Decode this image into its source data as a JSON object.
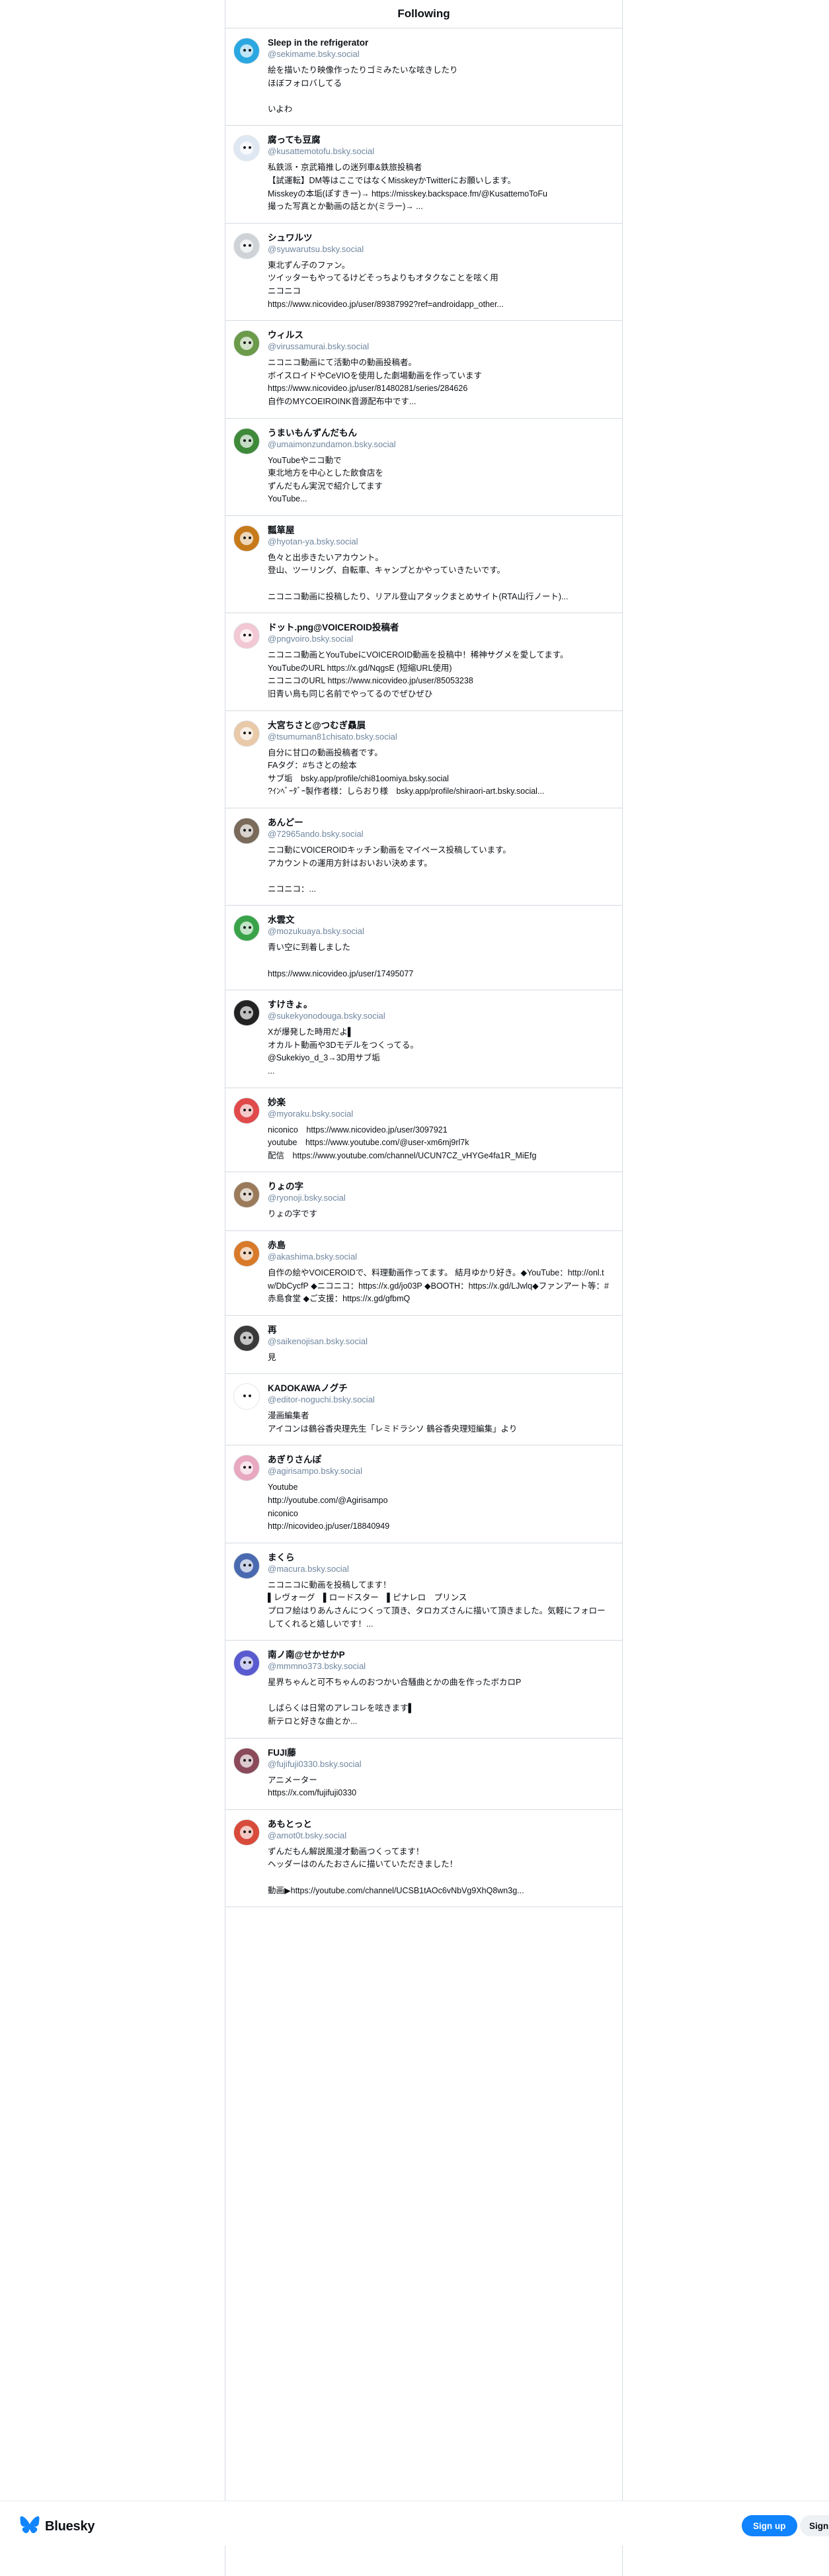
{
  "header": {
    "title": "Following"
  },
  "footer": {
    "brand": "Bluesky",
    "signup_label": "Sign up",
    "signin_label": "Sign in"
  },
  "follows": [
    {
      "name": "Sleep in the refrigerator",
      "handle": "@sekimame.bsky.social",
      "description": "絵を描いたり映像作ったりゴミみたいな呟きしたり\nほぼフォロバしてる\n\nいよわ",
      "avatar_color": "#2aa7e0"
    },
    {
      "name": "腐っても豆腐",
      "handle": "@kusattemotofu.bsky.social",
      "description": "私鉄派・京武箱推しの迷列車&鉄旅投稿者\n【試運転】DM等はここではなくMisskeyかTwitterにお願いします。\nMisskeyの本垢(ぽすきー)→ https://misskey.backspace.fm/@KusattemoToFu\n撮った写真とか動画の話とか(ミラー)→ ...",
      "avatar_color": "#dfe8f2"
    },
    {
      "name": "シュワルツ",
      "handle": "@syuwarutsu.bsky.social",
      "description": "東北ずん子のファン。\nツイッターもやってるけどそっちよりもオタクなことを呟く用\nニコニコ\nhttps://www.nicovideo.jp/user/89387992?ref=androidapp_other...",
      "avatar_color": "#cfd3d8"
    },
    {
      "name": "ウィルス",
      "handle": "@virussamurai.bsky.social",
      "description": "ニコニコ動画にて活動中の動画投稿者。\nボイスロイドやCeVIOを使用した劇場動画を作っています\nhttps://www.nicovideo.jp/user/81480281/series/284626\n自作のMYCOEIROINK音源配布中です...",
      "avatar_color": "#6a9a4a"
    },
    {
      "name": "うまいもんずんだもん",
      "handle": "@umaimonzundamon.bsky.social",
      "description": "YouTubeやニコ動で\n東北地方を中心とした飲食店を\nずんだもん実況で紹介してます\nYouTube...",
      "avatar_color": "#3f8a3a"
    },
    {
      "name": "瓢箪屋",
      "handle": "@hyotan-ya.bsky.social",
      "description": "色々と出歩きたいアカウント。\n登山、ツーリング、自転車、キャンプとかやっていきたいです。\n\nニコニコ動画に投稿したり、リアル登山アタックまとめサイト(RTA山行ノート)...",
      "avatar_color": "#c77a1a"
    },
    {
      "name": "ドット.png@VOICEROID投稿者",
      "handle": "@pngvoiro.bsky.social",
      "description": "ニコニコ動画とYouTubeにVOICEROID動画を投稿中！稀神サグメを愛してます。\nYouTubeのURL https://x.gd/NqgsE (短縮URL使用)\nニコニコのURL https://www.nicovideo.jp/user/85053238\n旧青い鳥も同じ名前でやってるのでぜひぜひ",
      "avatar_color": "#f2c8d4"
    },
    {
      "name": "大宮ちさと@つむぎ贔屓",
      "handle": "@tsumuman81chisato.bsky.social",
      "description": "自分に甘口の動画投稿者です。\nFAタグ：#ちさとの絵本\nサブ垢　bsky.app/profile/chi81oomiya.bsky.social\n?ｲﾝﾍﾞｰﾀﾞｰ製作者様：しらおり様　bsky.app/profile/shiraori-art.bsky.social...",
      "avatar_color": "#e8c9a8"
    },
    {
      "name": "あんどー",
      "handle": "@72965ando.bsky.social",
      "description": "ニコ動にVOICEROIDキッチン動画をマイペース投稿しています。\nアカウントの運用方針はおいおい決めます。\n\nニコニコ：...",
      "avatar_color": "#7a6a5a"
    },
    {
      "name": "水雲文",
      "handle": "@mozukuaya.bsky.social",
      "description": "青い空に到着しました\n\nhttps://www.nicovideo.jp/user/17495077",
      "avatar_color": "#3aa34a"
    },
    {
      "name": "すけきょ。",
      "handle": "@sukekyonodouga.bsky.social",
      "description": "Xが爆発した時用だよ▌\nオカルト動画や3Dモデルをつくってる。\n@Sukekiyo_d_3→3D用サブ垢\n...",
      "avatar_color": "#222222"
    },
    {
      "name": "妙楽",
      "handle": "@myoraku.bsky.social",
      "description": "niconico　https://www.nicovideo.jp/user/3097921\nyoutube　https://www.youtube.com/@user-xm6mj9rl7k\n配信　https://www.youtube.com/channel/UCUN7CZ_vHYGe4fa1R_MiEfg",
      "avatar_color": "#e04a4a"
    },
    {
      "name": "りょの字",
      "handle": "@ryonoji.bsky.social",
      "description": "りょの字です",
      "avatar_color": "#9a7a5a"
    },
    {
      "name": "赤島",
      "handle": "@akashima.bsky.social",
      "description": "自作の絵やVOICEROIDで、料理動画作ってます。 結月ゆかり好き。◆YouTube：http://onl.tw/DbCycfP ◆ニコニコ：https://x.gd/jo03P ◆BOOTH：https://x.gd/LJwlq◆ファンアート等：#赤島食堂 ◆ご支援：https://x.gd/gfbmQ",
      "avatar_color": "#d87a2a"
    },
    {
      "name": "再",
      "handle": "@saikenojisan.bsky.social",
      "description": "見",
      "avatar_color": "#3a3a3a"
    },
    {
      "name": "KADOKAWAノグチ",
      "handle": "@editor-noguchi.bsky.social",
      "description": "漫画編集者\nアイコンは鶴谷香央理先生「レミドラシソ 鶴谷香央理短編集」より",
      "avatar_color": "#ffffff"
    },
    {
      "name": "あぎりさんぽ",
      "handle": "@agirisampo.bsky.social",
      "description": "Youtube\nhttp://youtube.com/@Agirisampo\nniconico\nhttp://nicovideo.jp/user/18840949",
      "avatar_color": "#e8a8c0"
    },
    {
      "name": "まくら",
      "handle": "@macura.bsky.social",
      "description": "ニコニコに動画を投稿してます！\n▌レヴォーグ　▌ロードスター　▌ピナレロ　プリンス\nプロフ絵はりあんさんにつくって頂き、タロカズさんに描いて頂きました。気軽にフォローしてくれると嬉しいです！...",
      "avatar_color": "#4a6ab0"
    },
    {
      "name": "南ノ南@せかせかP",
      "handle": "@mmmno373.bsky.social",
      "description": "星界ちゃんと可不ちゃんのおつかい合騒曲とかの曲を作ったボカロP\n\nしばらくは日常のアレコレを呟きます▌\n新テロと好きな曲とか...",
      "avatar_color": "#5a5ad0"
    },
    {
      "name": "FUJI藤",
      "handle": "@fujifuji0330.bsky.social",
      "description": "アニメーター\nhttps://x.com/fujifuji0330",
      "avatar_color": "#8a4a5a"
    },
    {
      "name": "あもとっと",
      "handle": "@amot0t.bsky.social",
      "description": "ずんだもん解説風漫才動画つくってます！\nヘッダーはのんたおさんに描いていただきました！\n\n動画▶https://youtube.com/channel/UCSB1tAOc6vNbVg9XhQ8wn3g...",
      "avatar_color": "#d84a3a"
    }
  ]
}
